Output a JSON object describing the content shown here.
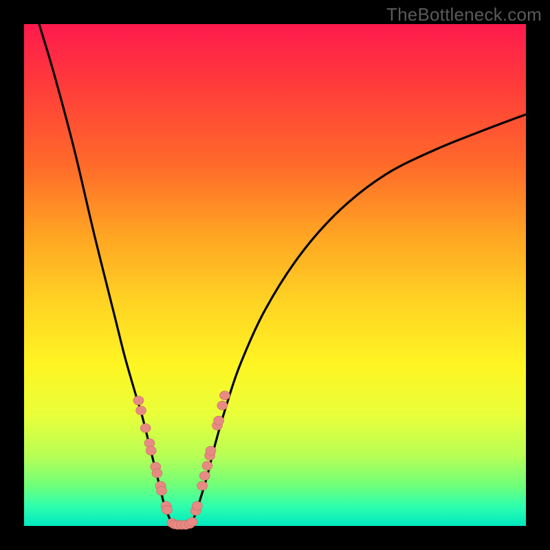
{
  "watermark": "TheBottleneck.com",
  "chart_data": {
    "type": "line",
    "title": "",
    "xlabel": "",
    "ylabel": "",
    "xlim": [
      0,
      100
    ],
    "ylim": [
      0,
      100
    ],
    "series": [
      {
        "name": "left-curve",
        "x": [
          3,
          6,
          10,
          14,
          18,
          20,
          22,
          23.5,
          25,
          26,
          27,
          28,
          29,
          30
        ],
        "y": [
          100,
          90,
          75,
          58,
          42,
          34,
          27,
          22,
          16,
          12,
          8,
          4,
          1.5,
          0
        ]
      },
      {
        "name": "right-curve",
        "x": [
          33,
          34,
          35,
          36.5,
          38,
          40,
          43,
          48,
          55,
          63,
          72,
          82,
          92,
          100
        ],
        "y": [
          0,
          2,
          5,
          10,
          16,
          23,
          32,
          43,
          54,
          63,
          70,
          75,
          79,
          82
        ]
      },
      {
        "name": "valley",
        "x": [
          30,
          31,
          32,
          33
        ],
        "y": [
          0,
          0,
          0,
          0
        ]
      }
    ],
    "markers": {
      "left_cluster": [
        {
          "x": 22.8,
          "y": 25
        },
        {
          "x": 23.3,
          "y": 23
        },
        {
          "x": 24.2,
          "y": 19.5
        },
        {
          "x": 25.0,
          "y": 16.5
        },
        {
          "x": 25.3,
          "y": 15
        },
        {
          "x": 26.2,
          "y": 11.8
        },
        {
          "x": 26.5,
          "y": 10.5
        },
        {
          "x": 27.2,
          "y": 8
        },
        {
          "x": 27.4,
          "y": 7
        },
        {
          "x": 28.3,
          "y": 4
        },
        {
          "x": 28.5,
          "y": 3.2
        }
      ],
      "right_cluster": [
        {
          "x": 34.2,
          "y": 3
        },
        {
          "x": 34.5,
          "y": 4
        },
        {
          "x": 35.5,
          "y": 8
        },
        {
          "x": 36.0,
          "y": 10
        },
        {
          "x": 36.5,
          "y": 12
        },
        {
          "x": 37.0,
          "y": 14
        },
        {
          "x": 37.2,
          "y": 15
        },
        {
          "x": 38.5,
          "y": 20
        },
        {
          "x": 38.8,
          "y": 21
        },
        {
          "x": 39.5,
          "y": 24
        },
        {
          "x": 40.0,
          "y": 26
        }
      ],
      "valley_cluster": [
        {
          "x": 29.5,
          "y": 0.6
        },
        {
          "x": 30.0,
          "y": 0.3
        },
        {
          "x": 30.6,
          "y": 0.2
        },
        {
          "x": 31.4,
          "y": 0.2
        },
        {
          "x": 32.2,
          "y": 0.2
        },
        {
          "x": 33.0,
          "y": 0.4
        },
        {
          "x": 33.5,
          "y": 0.8
        }
      ]
    },
    "colors": {
      "curve": "#000000",
      "marker_fill": "#e88a84",
      "marker_stroke": "#c86860"
    }
  }
}
